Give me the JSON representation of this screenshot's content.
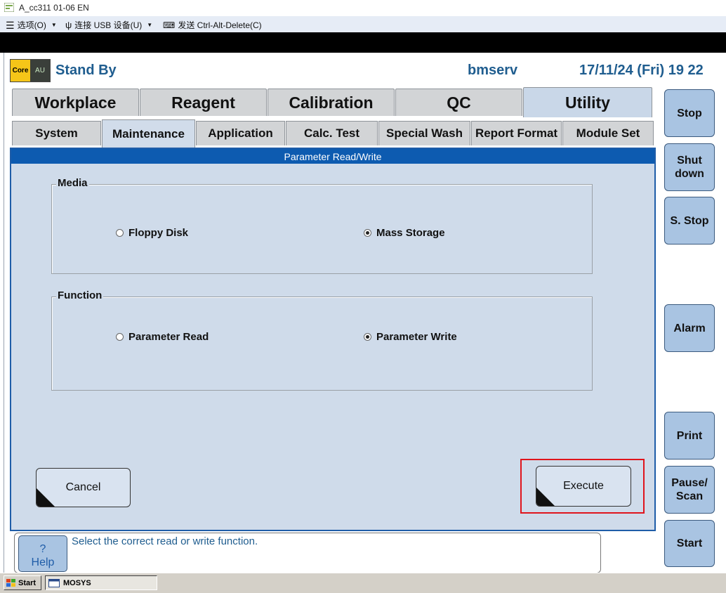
{
  "window": {
    "title": "A_cc311 01-06 EN"
  },
  "toolbar": {
    "options": "选项(O)",
    "usb": "连接 USB 设备(U)",
    "send_cad": "发送 Ctrl-Alt-Delete(C)"
  },
  "logo": {
    "core": "Core",
    "au": "AU"
  },
  "header": {
    "status": "Stand By",
    "user": "bmserv",
    "datetime": "17/11/24 (Fri) 19 22"
  },
  "main_tabs": [
    {
      "label": "Workplace",
      "active": false
    },
    {
      "label": "Reagent",
      "active": false
    },
    {
      "label": "Calibration",
      "active": false
    },
    {
      "label": "QC",
      "active": false
    },
    {
      "label": "Utility",
      "active": true
    }
  ],
  "sub_tabs": [
    {
      "label": "System",
      "active": false
    },
    {
      "label": "Maintenance",
      "active": true
    },
    {
      "label": "Application",
      "active": false
    },
    {
      "label": "Calc. Test",
      "active": false
    },
    {
      "label": "Special Wash",
      "active": false
    },
    {
      "label": "Report Format",
      "active": false
    },
    {
      "label": "Module Set",
      "active": false
    }
  ],
  "panel": {
    "title": "Parameter Read/Write",
    "media": {
      "label": "Media",
      "options": [
        {
          "label": "Floppy Disk",
          "selected": false
        },
        {
          "label": "Mass Storage",
          "selected": true
        }
      ]
    },
    "function": {
      "label": "Function",
      "options": [
        {
          "label": "Parameter Read",
          "selected": false
        },
        {
          "label": "Parameter Write",
          "selected": true
        }
      ]
    },
    "cancel_label": "Cancel",
    "execute_label": "Execute"
  },
  "side_buttons": {
    "stop": "Stop",
    "shutdown_l1": "Shut",
    "shutdown_l2": "down",
    "s_stop": "S. Stop",
    "alarm": "Alarm",
    "print": "Print",
    "pause_l1": "Pause/",
    "pause_l2": "Scan",
    "start": "Start"
  },
  "message": {
    "help_icon": "?",
    "help_label": "Help",
    "text": "Select the correct read or write function."
  },
  "taskbar": {
    "start": "Start",
    "item": "MOSYS"
  },
  "colors": {
    "header_text": "#1f5d8f",
    "panel_bg": "#cfdbea",
    "panel_header": "#0d5bb0",
    "side_button": "#a9c4e2",
    "highlight": "#e0141c"
  }
}
